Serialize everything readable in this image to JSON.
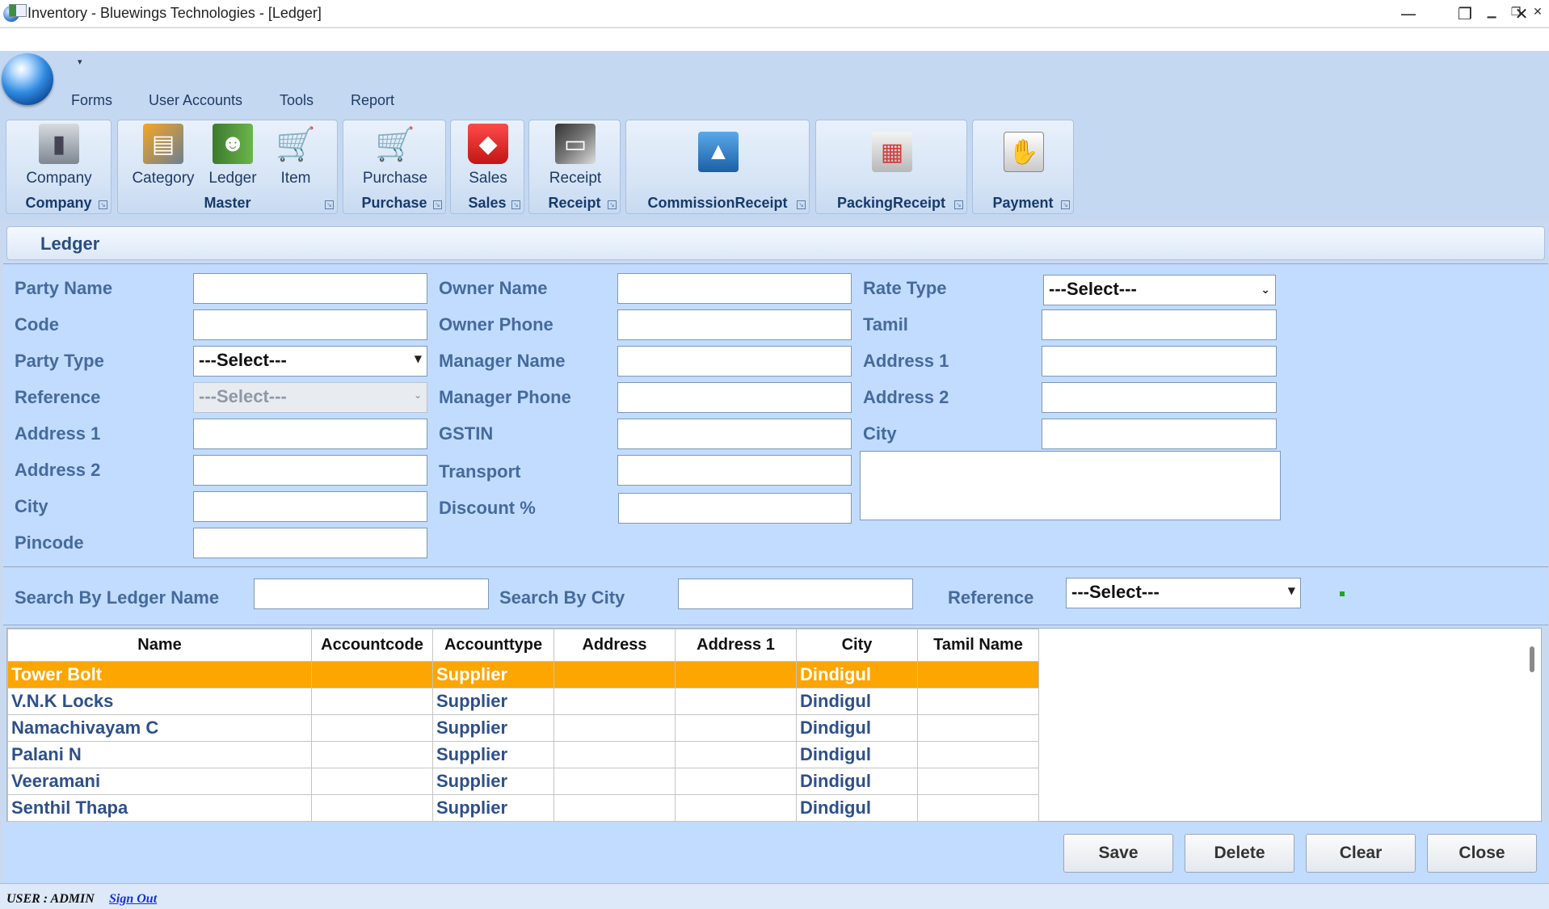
{
  "window": {
    "title": "Inventory - Bluewings Technologies - [Ledger]",
    "minimize": "—",
    "restore": "❐",
    "close": "✕"
  },
  "mdi": {
    "minimize": "▁",
    "restore": "❐",
    "close": "✕"
  },
  "menu": [
    "Forms",
    "User Accounts",
    "Tools",
    "Report"
  ],
  "ribbon": {
    "groups": [
      {
        "label": "Company",
        "buttons": [
          {
            "label": "Company",
            "icon": "company-icon"
          }
        ]
      },
      {
        "label": "Master",
        "buttons": [
          {
            "label": "Category",
            "icon": "category-icon"
          },
          {
            "label": "Ledger",
            "icon": "ledger-book-icon"
          },
          {
            "label": "Item",
            "icon": "cart-icon"
          }
        ]
      },
      {
        "label": "Purchase",
        "buttons": [
          {
            "label": "Purchase",
            "icon": "purchase-cart-icon"
          }
        ]
      },
      {
        "label": "Sales",
        "buttons": [
          {
            "label": "Sales",
            "icon": "shopping-bag-icon"
          }
        ]
      },
      {
        "label": "Receipt",
        "buttons": [
          {
            "label": "Receipt",
            "icon": "receipt-card-icon"
          }
        ]
      },
      {
        "label": "CommissionReceipt",
        "buttons": [
          {
            "label": "",
            "icon": "chart-icon"
          }
        ]
      },
      {
        "label": "PackingReceipt",
        "buttons": [
          {
            "label": "",
            "icon": "calendar-icon"
          }
        ]
      },
      {
        "label": "Payment",
        "buttons": [
          {
            "label": "",
            "icon": "payment-hand-icon"
          }
        ]
      }
    ]
  },
  "ledger": {
    "title": "Ledger"
  },
  "form": {
    "col1": {
      "party_name": "Party Name",
      "code": "Code",
      "party_type": "Party Type",
      "reference": "Reference",
      "address1": "Address 1",
      "address2": "Address 2",
      "city": "City",
      "pincode": "Pincode",
      "party_type_value": "---Select---",
      "reference_value": "---Select---"
    },
    "col2": {
      "owner_name": "Owner Name",
      "owner_phone": "Owner Phone",
      "manager_name": "Manager Name",
      "manager_phone": "Manager Phone",
      "gstin": "GSTIN",
      "transport": "Transport",
      "discount": "Discount %"
    },
    "col3": {
      "rate_type": "Rate Type",
      "rate_type_value": "---Select---",
      "tamil": "Tamil",
      "address1": "Address 1",
      "address2": "Address 2",
      "city": "City"
    }
  },
  "search": {
    "by_ledger_label": "Search By Ledger Name",
    "by_city_label": "Search By City",
    "reference_label": "Reference",
    "reference_value": "---Select---"
  },
  "grid": {
    "columns": [
      "Name",
      "Accountcode",
      "Accounttype",
      "Address",
      "Address 1",
      "City",
      "Tamil Name"
    ],
    "rows": [
      [
        "Tower Bolt",
        "",
        "Supplier",
        "",
        "",
        "Dindigul",
        ""
      ],
      [
        "V.N.K Locks",
        "",
        "Supplier",
        "",
        "",
        "Dindigul",
        ""
      ],
      [
        "Namachivayam C",
        "",
        "Supplier",
        "",
        "",
        "Dindigul",
        ""
      ],
      [
        "Palani N",
        "",
        "Supplier",
        "",
        "",
        "Dindigul",
        ""
      ],
      [
        "Veeramani",
        "",
        "Supplier",
        "",
        "",
        "Dindigul",
        ""
      ],
      [
        "Senthil Thapa",
        "",
        "Supplier",
        "",
        "",
        "Dindigul",
        ""
      ]
    ]
  },
  "actions": {
    "save": "Save",
    "delete": "Delete",
    "clear": "Clear",
    "close": "Close"
  },
  "status": {
    "user": "USER :  ADMIN",
    "sign_out": "Sign Out"
  }
}
